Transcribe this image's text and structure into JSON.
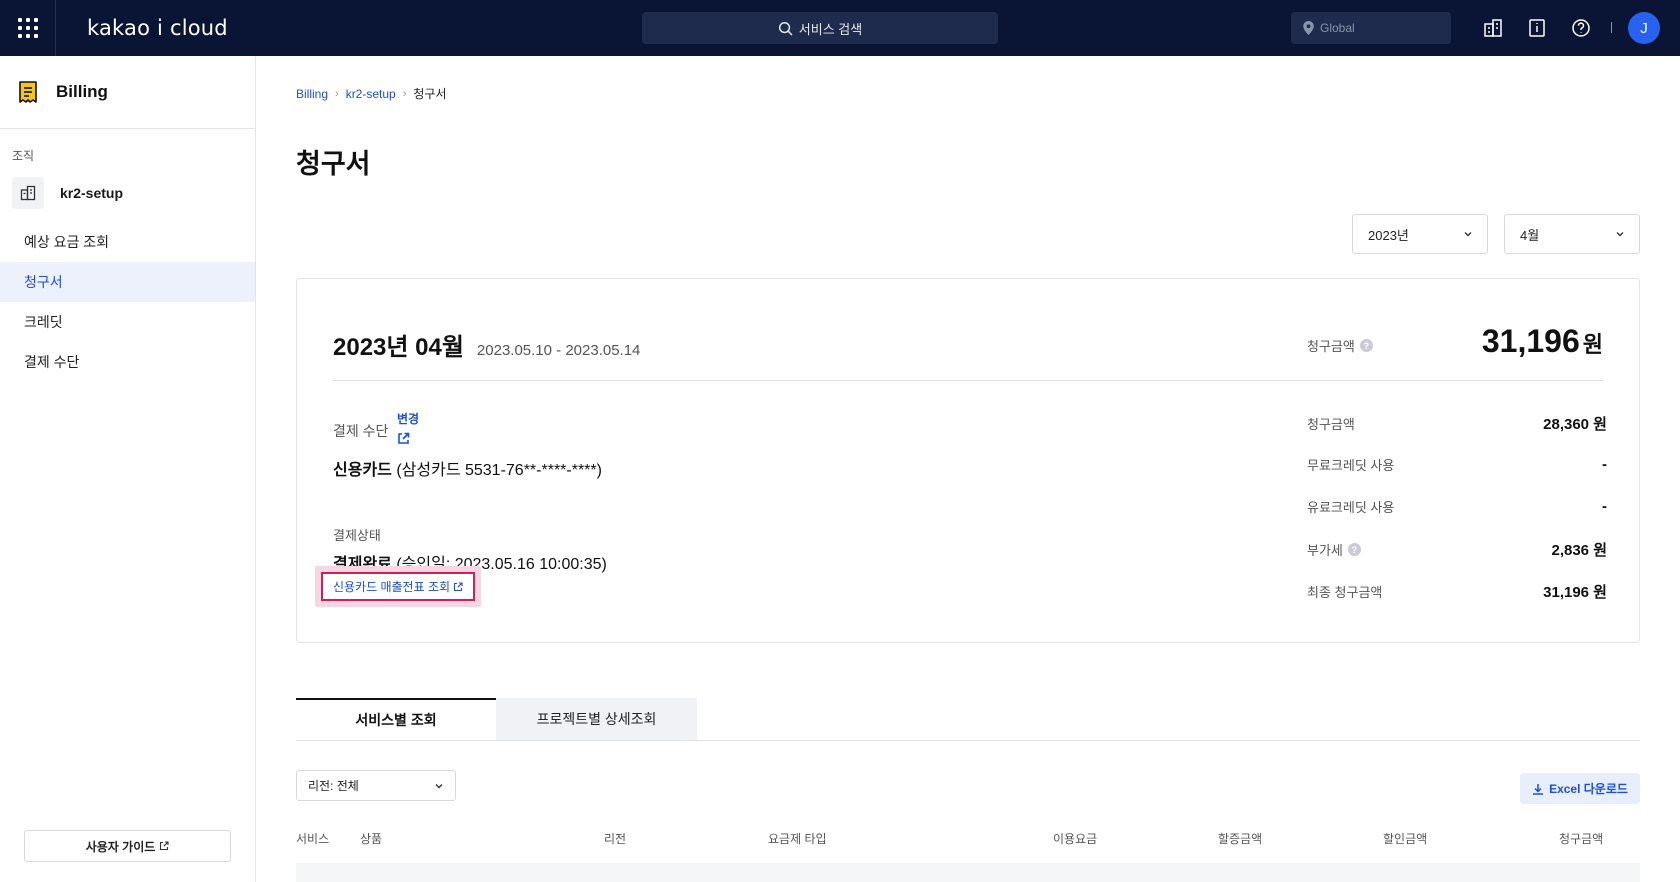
{
  "topbar": {
    "logo": "kakao i cloud",
    "search_placeholder": "서비스 검색",
    "region": "Global",
    "avatar_initial": "J"
  },
  "sidebar": {
    "title": "Billing",
    "org_label": "조직",
    "org_name": "kr2-setup",
    "items": [
      {
        "label": "예상 요금 조회",
        "active": false
      },
      {
        "label": "청구서",
        "active": true
      },
      {
        "label": "크레딧",
        "active": false
      },
      {
        "label": "결제 수단",
        "active": false
      }
    ],
    "guide_label": "사용자 가이드"
  },
  "breadcrumb": [
    "Billing",
    "kr2-setup",
    "청구서"
  ],
  "page_title": "청구서",
  "filters": {
    "year": "2023년",
    "month": "4월"
  },
  "invoice": {
    "period_title": "2023년 04월",
    "period_range": "2023.05.10 - 2023.05.14",
    "total_label": "청구금액",
    "total_amount": "31,196",
    "total_unit": "원",
    "payment_method_label": "결제 수단",
    "payment_method_change": "변경",
    "payment_method_value_bold": "신용카드",
    "payment_method_value_rest": " (삼성카드 5531-76**-****-****)",
    "payment_status_label": "결제상태",
    "payment_status_bold": "결제완료",
    "payment_status_rest": " (승인일: 2023.05.16 10:00:35)",
    "receipt_link": "신용카드 매출전표 조회",
    "summary": [
      {
        "label": "청구금액",
        "value": "28,360 원",
        "help": false
      },
      {
        "label": "무료크레딧 사용",
        "value": "-",
        "help": false
      },
      {
        "label": "유료크레딧 사용",
        "value": "-",
        "help": false
      },
      {
        "label": "부가세",
        "value": "2,836 원",
        "help": true
      },
      {
        "label": "최종 청구금액",
        "value": "31,196 원",
        "help": false
      }
    ]
  },
  "tabs": [
    {
      "label": "서비스별 조회",
      "active": true
    },
    {
      "label": "프로젝트별 상세조회",
      "active": false
    }
  ],
  "region_filter": "리전: 전체",
  "excel_button": "Excel 다운로드",
  "table_headers": [
    "서비스",
    "상품",
    "리전",
    "요금제 타입",
    "이용요금",
    "할증금액",
    "할인금액",
    "청구금액"
  ],
  "colors": {
    "topbar_bg": "#0a1535",
    "accent": "#1d4fd8",
    "highlight": "#d21f5b",
    "active_nav_bg": "#edf1fb"
  }
}
